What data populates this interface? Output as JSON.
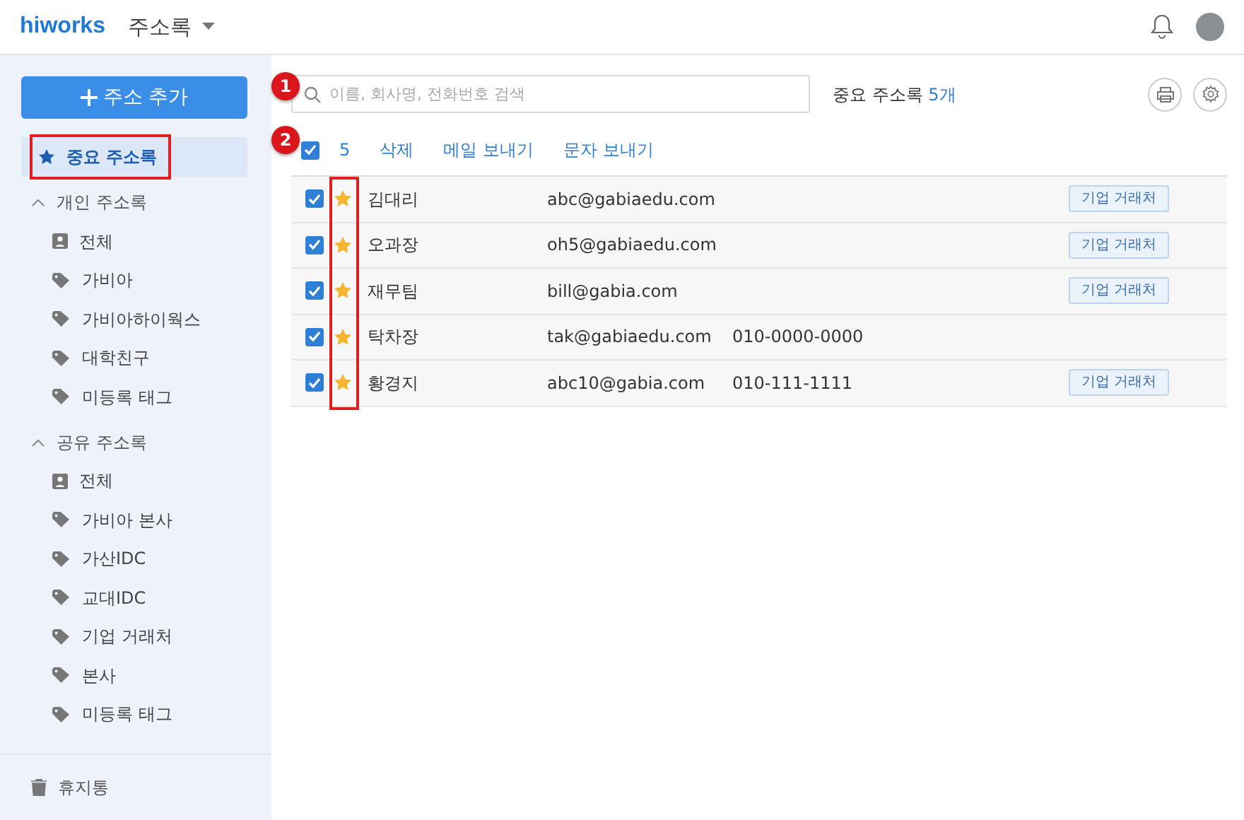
{
  "header": {
    "logo": "hiworks",
    "app_title": "주소록"
  },
  "sidebar": {
    "add_button": "주소 추가",
    "favorites": {
      "label": "중요 주소록",
      "selected": true,
      "highlighted": true
    },
    "groups": [
      {
        "label": "개인 주소록",
        "expanded": true,
        "children": [
          {
            "label": "전체",
            "kind": "all"
          },
          {
            "label": "가비아",
            "kind": "tag"
          },
          {
            "label": "가비아하이웍스",
            "kind": "tag"
          },
          {
            "label": "대학친구",
            "kind": "tag"
          },
          {
            "label": "미등록 태그",
            "kind": "tag"
          }
        ]
      },
      {
        "label": "공유 주소록",
        "expanded": true,
        "children": [
          {
            "label": "전체",
            "kind": "all"
          },
          {
            "label": "가비아 본사",
            "kind": "tag"
          },
          {
            "label": "가산IDC",
            "kind": "tag"
          },
          {
            "label": "교대IDC",
            "kind": "tag"
          },
          {
            "label": "기업 거래처",
            "kind": "tag"
          },
          {
            "label": "본사",
            "kind": "tag"
          },
          {
            "label": "미등록 태그",
            "kind": "tag"
          }
        ]
      }
    ],
    "trash": "휴지통"
  },
  "search": {
    "placeholder": "이름, 회사명, 전화번호 검색"
  },
  "summary": {
    "label": "중요 주소록",
    "count": "5개"
  },
  "toolbar": {
    "all_checked": true,
    "selected_count": "5",
    "actions": [
      "삭제",
      "메일 보내기",
      "문자 보내기"
    ]
  },
  "contacts": [
    {
      "checked": true,
      "starred": true,
      "name": "김대리",
      "email": "abc@gabiaedu.com",
      "tag": "기업 거래처"
    },
    {
      "checked": true,
      "starred": true,
      "name": "오과장",
      "email": "oh5@gabiaedu.com",
      "tag": "기업 거래처"
    },
    {
      "checked": true,
      "starred": true,
      "name": "재무팀",
      "email": "bill@gabia.com",
      "tag": "기업 거래처"
    },
    {
      "checked": true,
      "starred": true,
      "name": "탁차장",
      "email": "tak@gabiaedu.com",
      "phone": "010-0000-0000"
    },
    {
      "checked": true,
      "starred": true,
      "name": "황경지",
      "email": "abc10@gabia.com",
      "phone": "010-111-1111",
      "tag": "기업 거래처"
    }
  ],
  "star_column_highlighted": true,
  "annotations": [
    {
      "label": "1"
    },
    {
      "label": "2"
    }
  ]
}
